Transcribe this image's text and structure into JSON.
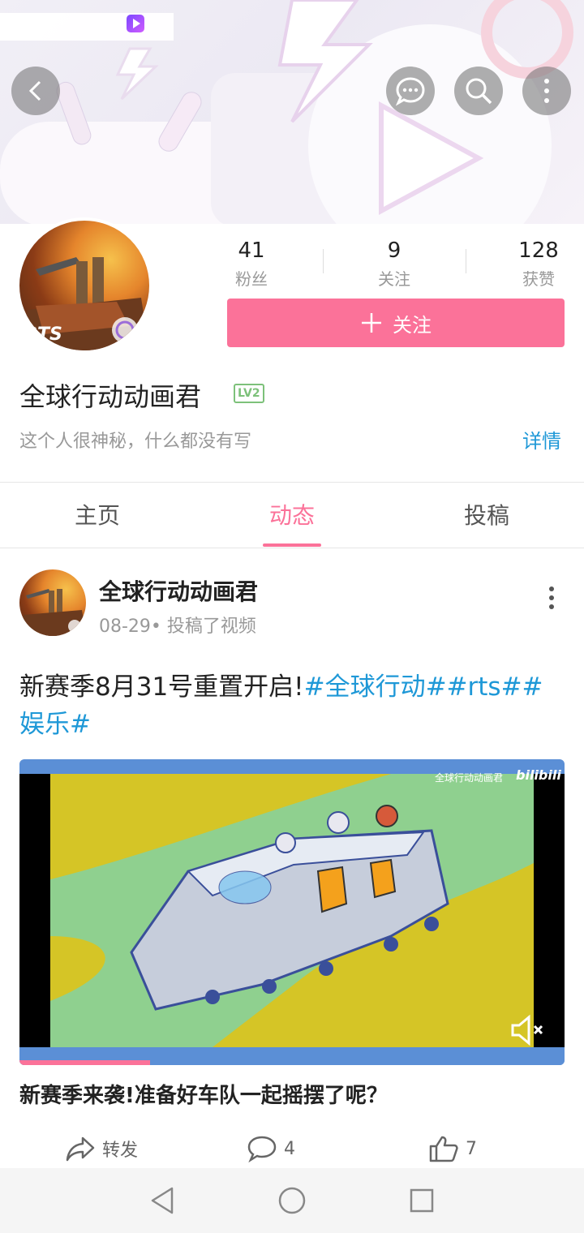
{
  "header": {
    "back_icon": "back-arrow-icon",
    "message_icon": "chat-bubble-icon",
    "search_icon": "search-icon",
    "more_icon": "more-vertical-icon"
  },
  "profile": {
    "avatar_text": "RTS",
    "stats": [
      {
        "value": "41",
        "label": "粉丝"
      },
      {
        "value": "9",
        "label": "关注"
      },
      {
        "value": "128",
        "label": "获赞"
      }
    ],
    "follow_button": "关注",
    "username": "全球行动动画君",
    "level_badge": "LV2",
    "bio": "这个人很神秘，什么都没有写",
    "details_link": "详情"
  },
  "tabs": [
    {
      "label": "主页",
      "active": false
    },
    {
      "label": "动态",
      "active": true
    },
    {
      "label": "投稿",
      "active": false
    }
  ],
  "post": {
    "author": "全球行动动画君",
    "meta": "08-29• 投稿了视频",
    "text_plain": "新赛季8月31号重置开启!",
    "text_hashtags": "#全球行动##rts##娱乐#",
    "video_watermark": "全球行动动画君",
    "video_brand": "bilibili",
    "video_progress": 0.24,
    "video_title": "新赛季来袭!准备好车队一起摇摆了呢？",
    "actions": {
      "share_label": "转发",
      "comment_count": "4",
      "like_count": "7"
    }
  },
  "colors": {
    "accent": "#fb7299",
    "link": "#1e98d7",
    "level_badge": "#7dc17a"
  }
}
